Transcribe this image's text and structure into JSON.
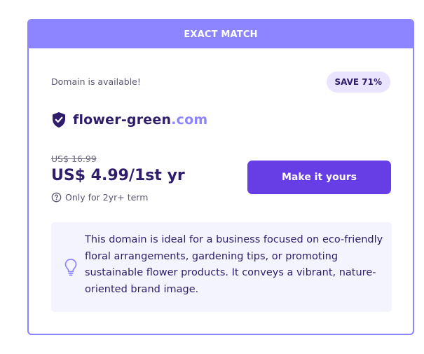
{
  "banner": {
    "label": "EXACT MATCH"
  },
  "availability": {
    "status": "Domain is available!"
  },
  "badge": {
    "label": "SAVE 71%"
  },
  "domain": {
    "name": "flower-green",
    "tld": ".com"
  },
  "pricing": {
    "old_price": "US$ 16.99",
    "new_price": "US$ 4.99/1st yr",
    "term_note": "Only for 2yr+ term"
  },
  "cta": {
    "label": "Make it yours"
  },
  "suggestion": {
    "text": "This domain is ideal for a business focused on eco-friendly floral arrangements, gardening tips, or promoting sustainable flower products. It conveys a vibrant, nature-oriented brand image."
  },
  "colors": {
    "accent": "#8c85ff",
    "primary": "#673de6",
    "text": "#2f1c6a",
    "badge_bg": "#ebe4ff",
    "suggestion_bg": "#f4f4fe"
  },
  "icons": {
    "domain": "shield-check-icon",
    "term": "question-circle-icon",
    "suggestion": "lightbulb-icon"
  }
}
